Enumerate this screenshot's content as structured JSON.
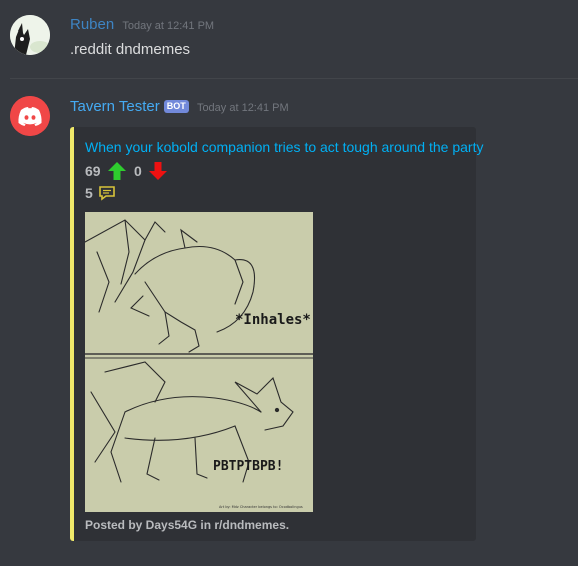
{
  "messages": [
    {
      "author": "Ruben",
      "timestamp": "Today at 12:41 PM",
      "content": ".reddit dndmemes"
    },
    {
      "author": "Tavern Tester",
      "tag": "BOT",
      "timestamp": "Today at 12:41 PM",
      "embed": {
        "title": "When your kobold companion tries to act tough around the party",
        "upvotes": "69",
        "downvotes": "0",
        "comments": "5",
        "image_text_top": "*Inhales*",
        "image_text_bottom": "PBTPTBPB!",
        "image_credit": "Art by: Mdz   Character belongs to: Ocodbolingus",
        "footer": "Posted by Days54G in r/dndmemes."
      }
    }
  ],
  "colors": {
    "background": "#36393f",
    "author_ruben": "#3e84c3",
    "author_bot": "#45aaf2",
    "embed_border": "#f0e96a",
    "link": "#00b0f4",
    "upvote": "#2ecc2e",
    "downvote": "#ee1111",
    "comment_icon": "#d8c43a",
    "discord_red": "#f04747"
  },
  "icons": {
    "upvote": "up-arrow-icon",
    "downvote": "down-arrow-icon",
    "comments": "speech-bubble-icon",
    "bot_avatar": "discord-logo-icon"
  }
}
